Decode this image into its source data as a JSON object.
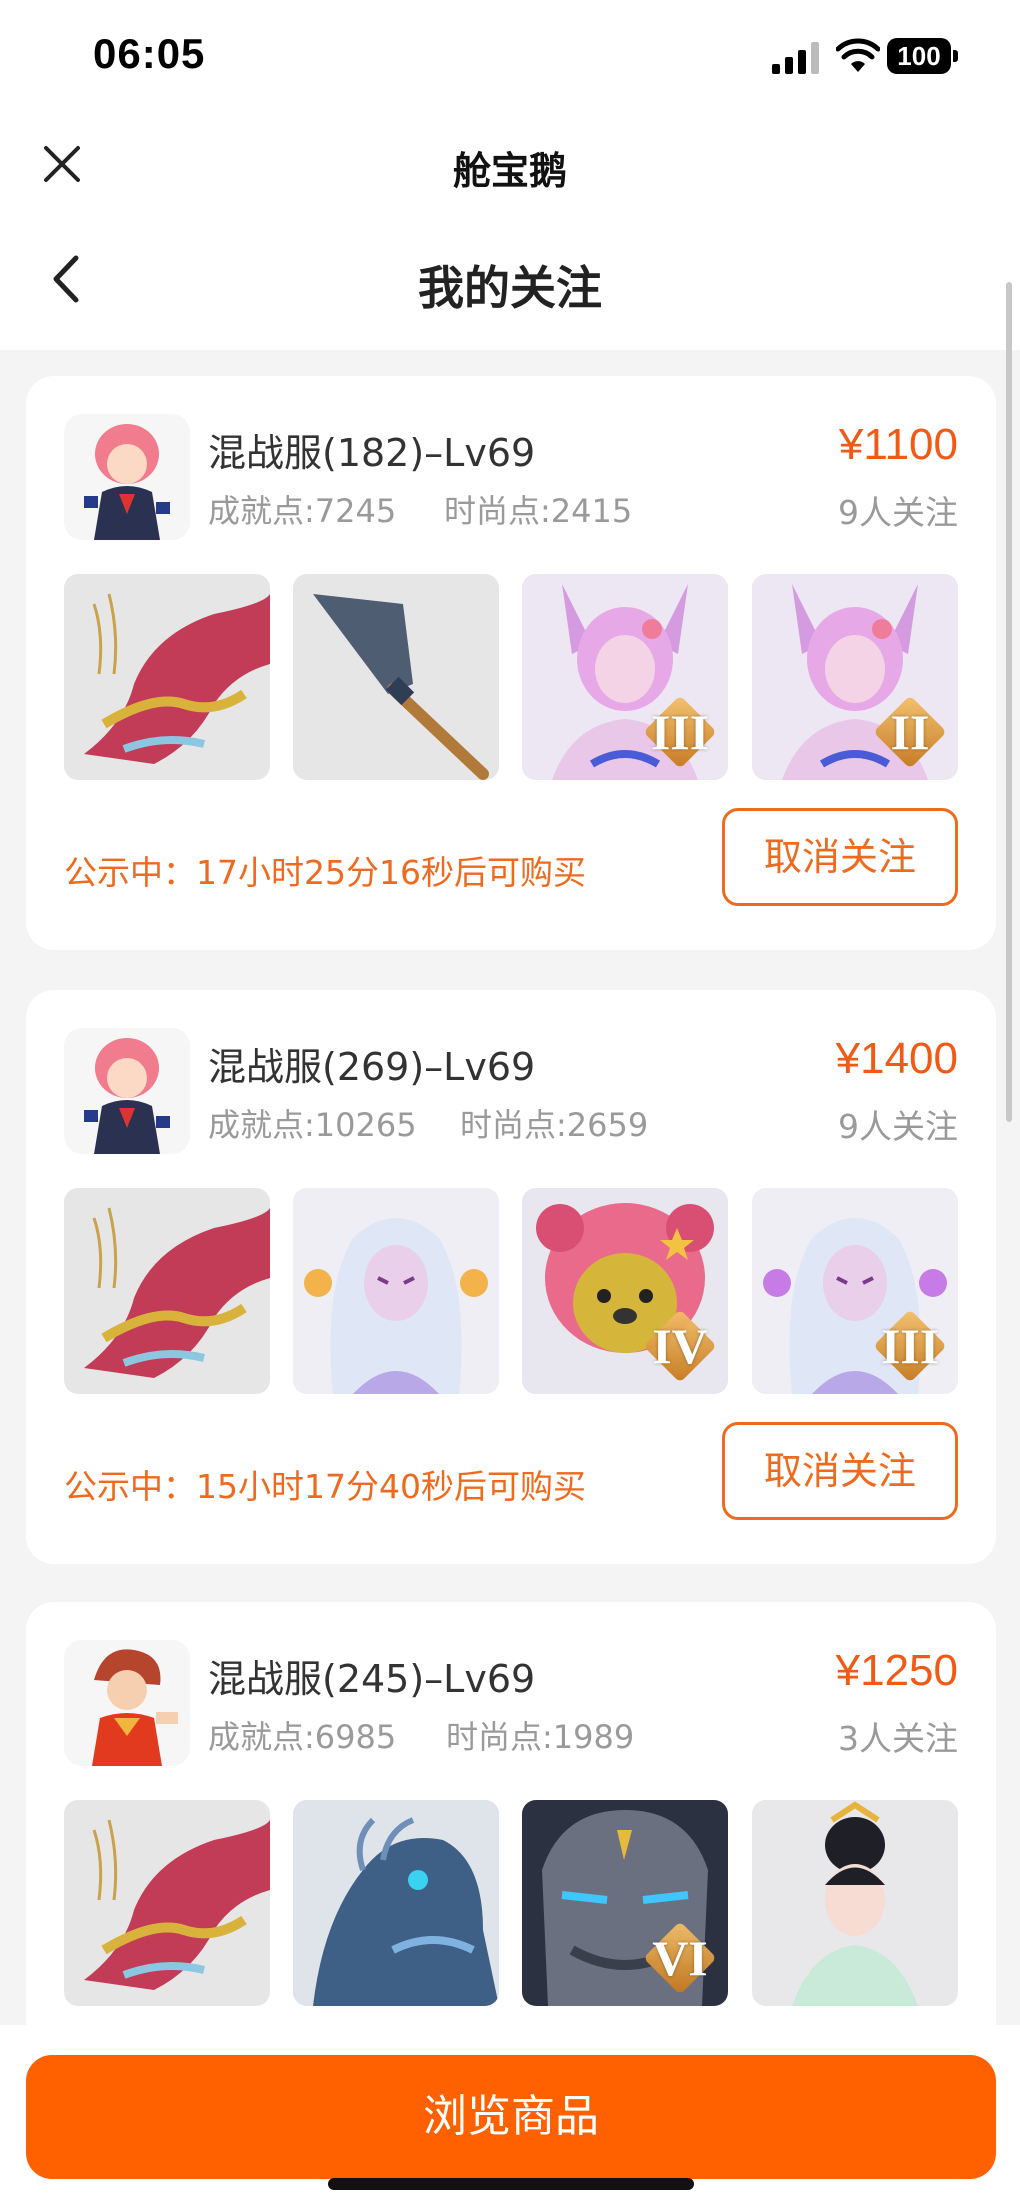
{
  "status_bar": {
    "time": "06:05",
    "battery": "100"
  },
  "header": {
    "app_title": "舱宝鹅",
    "page_title": "我的关注"
  },
  "cards": [
    {
      "server": "混战服(182)–Lv69",
      "achievement": "成就点:7245",
      "fashion": "时尚点:2415",
      "price": "¥1100",
      "followers": "9人关注",
      "notice": "公示中：17小时25分16秒后可购买",
      "unfollow": "取消关注",
      "avatar_icon": "pink-hair-girl-avatar",
      "items": [
        {
          "icon": "dragon-mount-icon",
          "tier": ""
        },
        {
          "icon": "spear-weapon-icon",
          "tier": ""
        },
        {
          "icon": "fox-girl-outfit-icon",
          "tier": "III"
        },
        {
          "icon": "fox-girl-outfit-icon",
          "tier": "II"
        }
      ]
    },
    {
      "server": "混战服(269)–Lv69",
      "achievement": "成就点:10265",
      "fashion": "时尚点:2659",
      "price": "¥1400",
      "followers": "9人关注",
      "notice": "公示中：15小时17分40秒后可购买",
      "unfollow": "取消关注",
      "avatar_icon": "pink-hair-girl-avatar",
      "items": [
        {
          "icon": "dragon-mount-icon",
          "tier": ""
        },
        {
          "icon": "white-hair-spirit-icon",
          "tier": ""
        },
        {
          "icon": "pink-bear-pet-icon",
          "tier": "IV"
        },
        {
          "icon": "white-hair-spirit-icon",
          "tier": "III"
        }
      ]
    },
    {
      "server": "混战服(245)–Lv69",
      "achievement": "成就点:6985",
      "fashion": "时尚点:1989",
      "price": "¥1250",
      "followers": "3人关注",
      "avatar_icon": "red-hair-boy-avatar",
      "items": [
        {
          "icon": "dragon-mount-icon",
          "tier": ""
        },
        {
          "icon": "ice-horse-mount-icon",
          "tier": ""
        },
        {
          "icon": "stone-golem-pet-icon",
          "tier": "VI"
        },
        {
          "icon": "princess-outfit-icon",
          "tier": ""
        }
      ]
    }
  ],
  "bottom": {
    "browse_label": "浏览商品"
  },
  "colors": {
    "accent": "#ff6000",
    "price": "#f05a16",
    "notice": "#ee6a1e"
  }
}
